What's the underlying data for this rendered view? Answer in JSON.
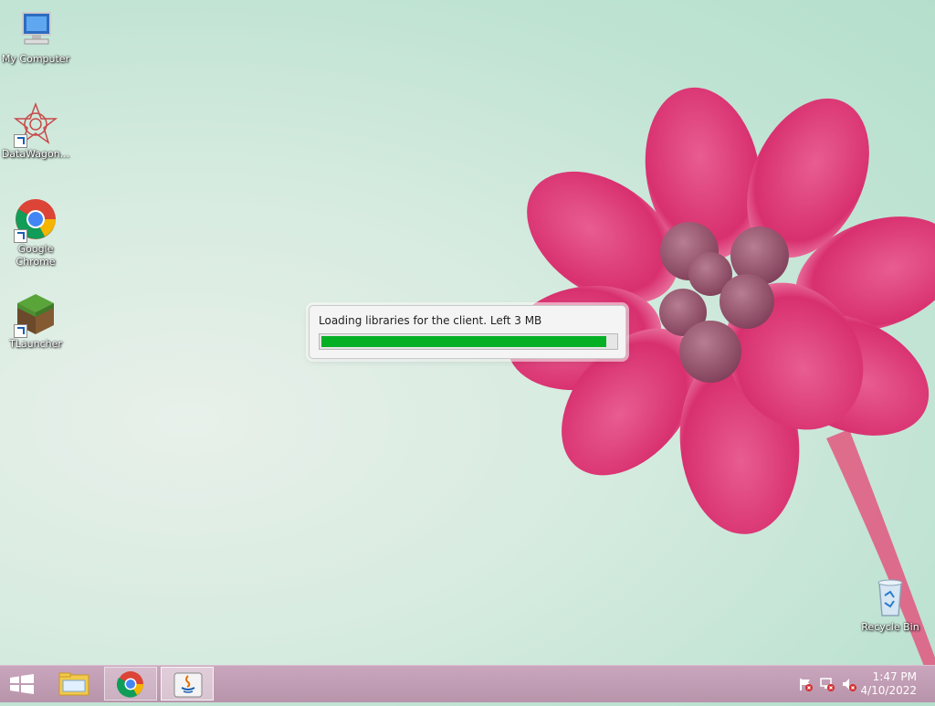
{
  "desktop": {
    "icons": [
      {
        "label": "My Computer",
        "icon": "computer-icon"
      },
      {
        "label": "DataWagon...",
        "icon": "datawagon-icon"
      },
      {
        "label": "Google Chrome",
        "icon": "chrome-icon"
      },
      {
        "label": "TLauncher",
        "icon": "minecraft-grass-icon"
      },
      {
        "label": "Recycle Bin",
        "icon": "recycle-bin-icon"
      }
    ]
  },
  "loader": {
    "message": "Loading libraries for the client. Left 3 MB",
    "progress": 0.97,
    "color": "#06b025"
  },
  "taskbar": {
    "buttons": [
      {
        "name": "start-button",
        "icon": "windows-logo-icon"
      },
      {
        "name": "file-explorer",
        "icon": "folder-icon"
      },
      {
        "name": "chrome",
        "icon": "chrome-icon"
      },
      {
        "name": "java",
        "icon": "java-icon"
      }
    ],
    "tray": [
      "action-center-flag-icon",
      "network-icon",
      "volume-muted-icon"
    ],
    "time": "1:47 PM",
    "date": "4/10/2022"
  },
  "colors": {
    "taskbar": "#c0a0b5",
    "wallpaper": "#c9e6d8",
    "flower": "#e0407f"
  }
}
